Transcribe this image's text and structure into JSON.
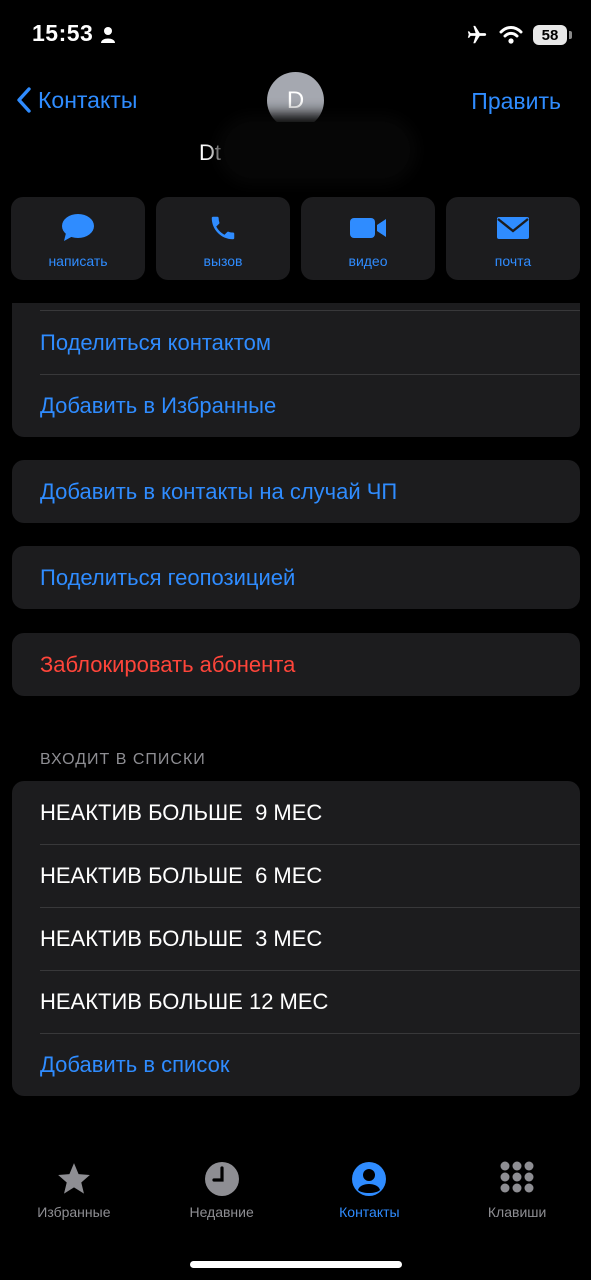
{
  "status_bar": {
    "time": "15:53",
    "battery": "58"
  },
  "nav": {
    "back_label": "Контакты",
    "edit_label": "Править"
  },
  "contact": {
    "initial": "D",
    "name_visible": "Dt"
  },
  "actions": [
    {
      "label": "написать",
      "icon": "message-icon"
    },
    {
      "label": "вызов",
      "icon": "phone-icon"
    },
    {
      "label": "видео",
      "icon": "video-icon"
    },
    {
      "label": "почта",
      "icon": "mail-icon"
    }
  ],
  "options_card": [
    {
      "label": "Поделиться контактом"
    },
    {
      "label": "Добавить в Избранные"
    }
  ],
  "emergency": {
    "label": "Добавить в контакты на случай ЧП"
  },
  "share_location": {
    "label": "Поделиться геопозицией"
  },
  "block": {
    "label": "Заблокировать абонента"
  },
  "lists_section": {
    "header": "ВХОДИТ В СПИСКИ",
    "items": [
      "НЕАКТИВ БОЛЬШЕ  9 МЕС",
      "НЕАКТИВ БОЛЬШЕ  6 МЕС",
      "НЕАКТИВ БОЛЬШЕ  3 МЕС",
      "НЕАКТИВ БОЛЬШЕ 12 МЕС"
    ],
    "add_label": "Добавить в список"
  },
  "tabbar": [
    {
      "label": "Избранные",
      "icon": "star-icon",
      "active": false
    },
    {
      "label": "Недавние",
      "icon": "clock-icon",
      "active": false
    },
    {
      "label": "Контакты",
      "icon": "person-circle-icon",
      "active": true
    },
    {
      "label": "Клавиши",
      "icon": "keypad-icon",
      "active": false
    }
  ],
  "colors": {
    "accent": "#2f8cff",
    "destructive": "#ff453a",
    "card": "#1c1c1e",
    "background": "#000000"
  }
}
